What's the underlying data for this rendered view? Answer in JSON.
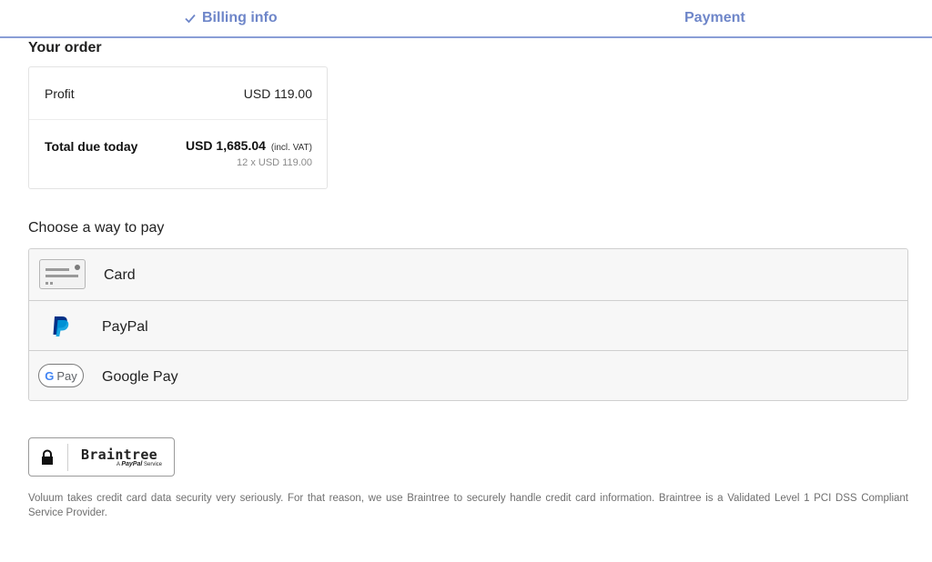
{
  "steps": {
    "billing_label": "Billing info",
    "payment_label": "Payment"
  },
  "order": {
    "title": "Your order",
    "profit_label": "Profit",
    "profit_value": "USD 119.00",
    "total_label": "Total due today",
    "total_value": "USD 1,685.04",
    "total_vat": "(incl. VAT)",
    "total_breakdown": "12 x USD 119.00"
  },
  "payment": {
    "title": "Choose a way to pay",
    "methods": [
      {
        "label": "Card",
        "icon": "credit-card-icon"
      },
      {
        "label": "PayPal",
        "icon": "paypal-icon"
      },
      {
        "label": "Google Pay",
        "icon": "google-pay-icon"
      }
    ],
    "gpay_icon_text": "Pay",
    "gpay_icon_g": "G"
  },
  "braintree": {
    "name": "Braintree",
    "sub_prefix": "A",
    "sub_brand": "PayPal",
    "sub_suffix": "Service"
  },
  "security_note": "Voluum takes credit card data security very seriously. For that reason, we use Braintree to securely handle credit card information. Braintree is a Validated Level 1 PCI DSS Compliant Service Provider.",
  "colors": {
    "step_accent": "#6e86c9",
    "step_border": "#8a9ed6",
    "paypal_dark": "#003087",
    "paypal_light": "#009cde"
  }
}
